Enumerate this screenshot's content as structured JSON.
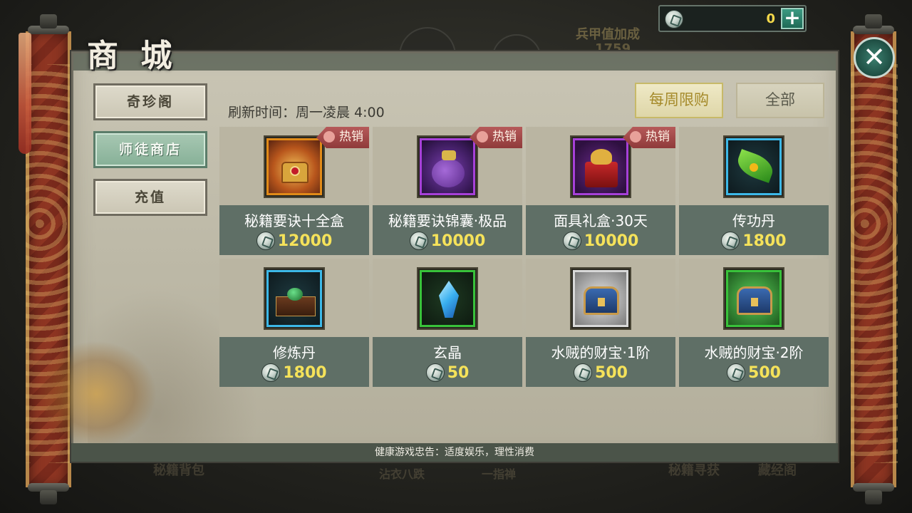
{
  "title": "商 城",
  "currency": {
    "amount": "0",
    "add_icon": "plus-icon",
    "coin_icon": "jade-coin-icon"
  },
  "close_icon": "close-icon",
  "nav": [
    {
      "label": "奇珍阁",
      "active": false
    },
    {
      "label": "师徒商店",
      "active": true
    },
    {
      "label": "充值",
      "active": false
    }
  ],
  "refresh_text": "刷新时间：周一凌晨 4:00",
  "filters": [
    {
      "label": "每周限购",
      "active": true
    },
    {
      "label": "全部",
      "active": false
    }
  ],
  "hot_label": "热销",
  "items": [
    {
      "name": "秘籍要诀十全盒",
      "price": "12000",
      "hot": true,
      "rarity": "orange",
      "icon": "golden-chest-icon"
    },
    {
      "name": "秘籍要诀锦囊·极品",
      "price": "10000",
      "hot": true,
      "rarity": "purple",
      "icon": "purple-pouch-icon"
    },
    {
      "name": "面具礼盒·30天",
      "price": "10000",
      "hot": true,
      "rarity": "purple",
      "icon": "mask-giftbox-icon"
    },
    {
      "name": "传功丹",
      "price": "1800",
      "hot": false,
      "rarity": "blue",
      "icon": "leaf-pill-icon"
    },
    {
      "name": "修炼丹",
      "price": "1800",
      "hot": false,
      "rarity": "blue",
      "icon": "pill-box-icon"
    },
    {
      "name": "玄晶",
      "price": "50",
      "hot": false,
      "rarity": "green",
      "icon": "blue-crystal-icon"
    },
    {
      "name": "水贼的财宝·1阶",
      "price": "500",
      "hot": false,
      "rarity": "white",
      "icon": "treasure-chest-icon"
    },
    {
      "name": "水贼的财宝·2阶",
      "price": "500",
      "hot": false,
      "rarity": "green",
      "icon": "treasure-chest-icon"
    }
  ],
  "footer": "健康游戏忠告：适度娱乐，理性消费",
  "background_text": [
    {
      "text": "兵甲值加成"
    },
    {
      "text": "1759"
    },
    {
      "text": "秘籍背包"
    },
    {
      "text": "沾衣八跌"
    },
    {
      "text": "一指禅"
    },
    {
      "text": "秘籍寻获"
    },
    {
      "text": "藏经阁"
    }
  ],
  "colors": {
    "orange": "#e08a18",
    "purple": "#a640d8",
    "blue": "#3cb8e8",
    "green": "#38c23a",
    "white": "#d8d8d8",
    "price": "#f5e25a",
    "accent": "#86b097"
  }
}
